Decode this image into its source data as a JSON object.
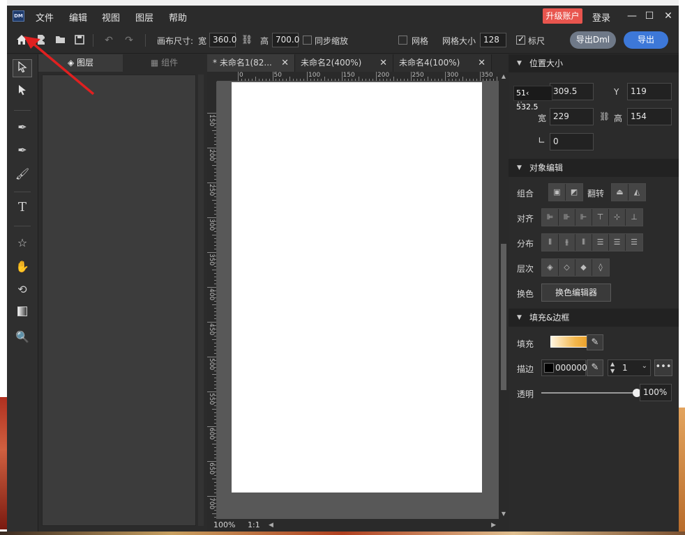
{
  "menu": {
    "file": "文件",
    "edit": "编辑",
    "view": "视图",
    "layer": "图层",
    "help": "帮助",
    "upgrade": "升级账户",
    "login": "登录",
    "logo": "DM"
  },
  "toolbar": {
    "canvas_size_label": "画布尺寸:",
    "width_label": "宽",
    "width_value": "360.0",
    "height_label": "高",
    "height_value": "700.0",
    "sync_scale": "同步缩放",
    "grid": "网格",
    "grid_size_label": "网格大小",
    "grid_size_value": "128",
    "ruler": "标尺",
    "ruler_checked": true,
    "export_dml": "导出Dml",
    "export": "导出"
  },
  "layer_panel": {
    "tab_layers": "图层",
    "tab_components": "组件"
  },
  "doc_tabs": [
    {
      "label": "* 未命名1(82..."
    },
    {
      "label": "未命名2(400%)"
    },
    {
      "label": "未命名4(100%)"
    }
  ],
  "ruler_top": [
    "0",
    "50",
    "100",
    "150",
    "200",
    "250",
    "300",
    "350"
  ],
  "ruler_left": [
    "150",
    "200",
    "250",
    "300",
    "350",
    "400",
    "450",
    "500",
    "550",
    "600",
    "650",
    "700"
  ],
  "status": {
    "zoom": "100%",
    "ratio": "1:1"
  },
  "props": {
    "position_size": {
      "title": "位置大小",
      "x_label": "X",
      "x_value": "309.5",
      "y_label": "Y",
      "y_value": "119",
      "w_label": "宽",
      "w_value": "229",
      "h_label": "高",
      "h_value": "154",
      "angle_value": "0",
      "tooltip": "51‹ 532.5"
    },
    "object_edit": {
      "title": "对象编辑",
      "group_label": "组合",
      "flip_label": "翻转",
      "align_label": "对齐",
      "distribute_label": "分布",
      "order_label": "层次",
      "recolor_label": "换色",
      "recolor_button": "换色编辑器"
    },
    "fill_border": {
      "title": "填充&边框",
      "fill_label": "填充",
      "stroke_label": "描边",
      "stroke_color": "000000",
      "stroke_width": "1",
      "opacity_label": "透明",
      "opacity_value": "100%",
      "opacity_fraction": 1.0
    }
  },
  "colors": {
    "upgrade": "#e8554e",
    "export": "#3d78d8",
    "export_dml": "#6f7988",
    "annotation_arrow": "#e02020"
  }
}
